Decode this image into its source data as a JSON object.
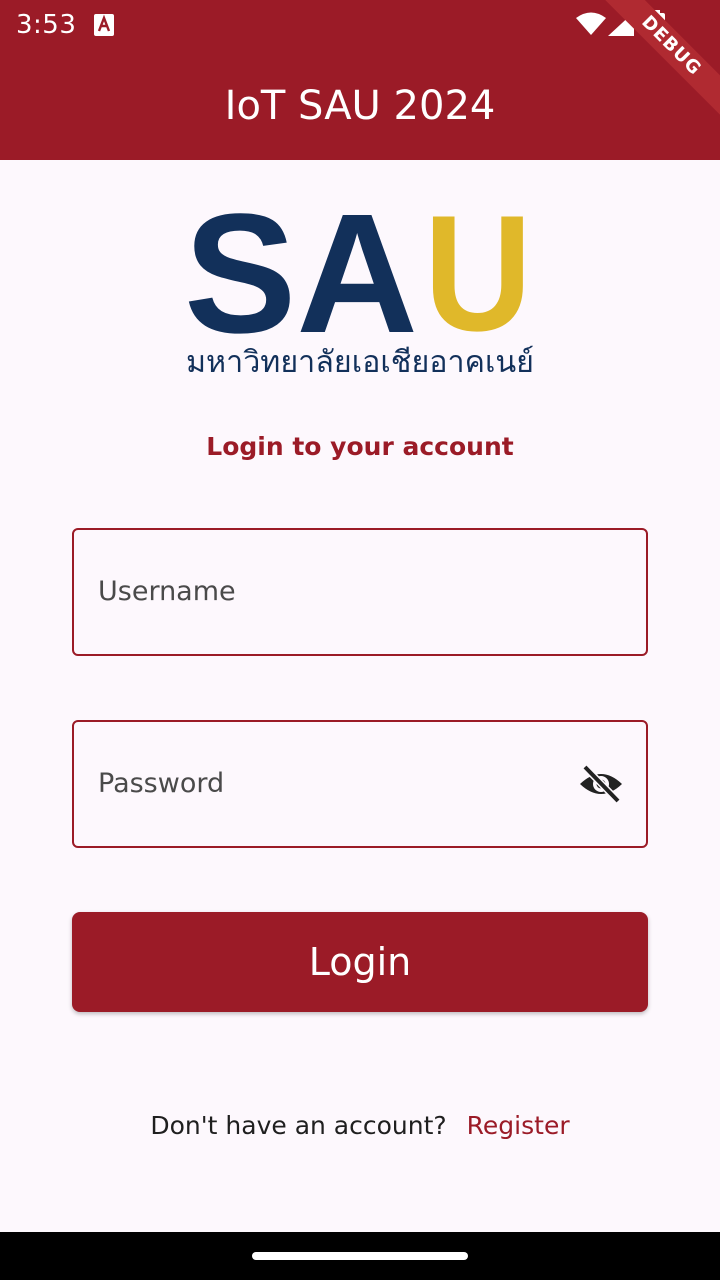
{
  "status_bar": {
    "time": "3:53",
    "icons": [
      "notification-a-icon",
      "wifi-icon",
      "signal-icon",
      "battery-icon"
    ]
  },
  "app_bar": {
    "title": "IoT SAU 2024",
    "debug_label": "DEBUG",
    "color": "#9b1b27"
  },
  "logo": {
    "letters_blue": "SA",
    "letter_gold": "U",
    "thai_text": "มหาวิทยาลัยเอเชียอาคเนย์",
    "blue": "#12305a",
    "gold": "#e0b82a"
  },
  "form": {
    "subtitle": "Login to your account",
    "username_placeholder": "Username",
    "password_placeholder": "Password",
    "password_visibility_icon": "eye-off-icon",
    "login_label": "Login"
  },
  "footer": {
    "prompt": "Don't have an account?",
    "register_label": "Register"
  }
}
